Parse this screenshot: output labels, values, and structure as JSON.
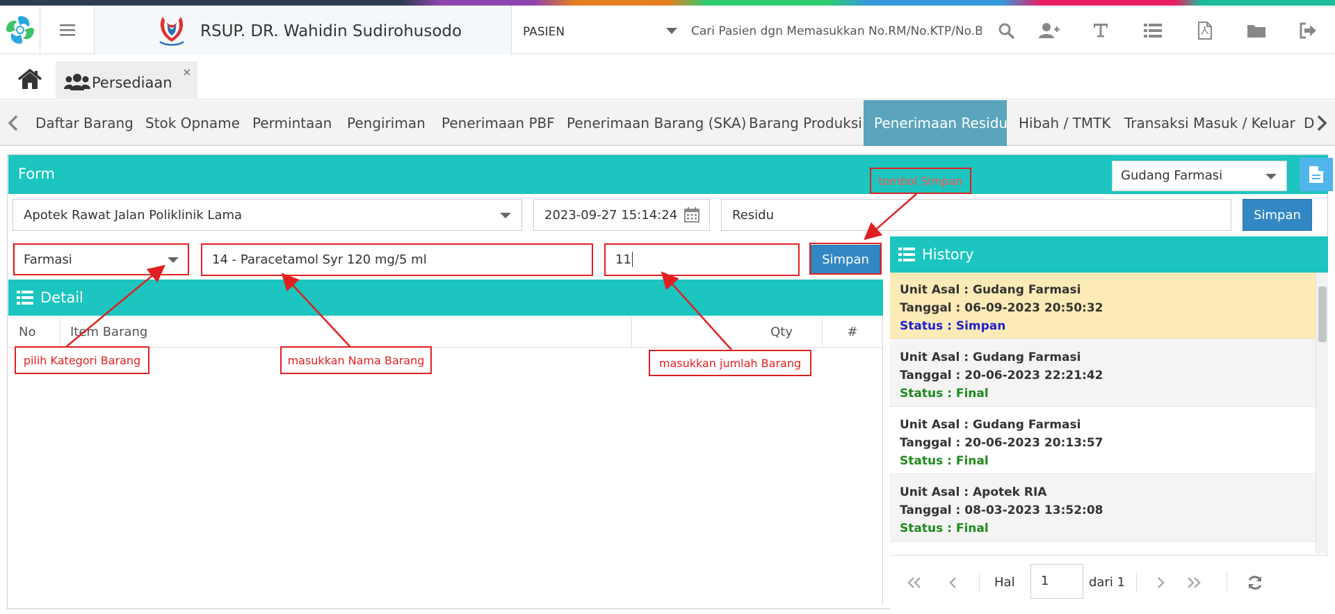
{
  "header": {
    "hospital_name": "RSUP. DR. Wahidin Sudirohusodo",
    "patient_select": "PASIEN",
    "search_placeholder": "Cari Pasien dgn Memasukkan No.RM/No.KTP/No.BPJS",
    "icons": [
      "search-icon",
      "add-user-icon",
      "text-icon",
      "list-icon",
      "pdf-icon",
      "folder-icon",
      "logout-icon"
    ]
  },
  "tabs": {
    "open_tab": "Persediaan",
    "close_symbol": "×"
  },
  "nav": {
    "items": [
      "Daftar Barang",
      "Stok Opname",
      "Permintaan",
      "Pengiriman",
      "Penerimaan PBF",
      "Penerimaan Barang (SKA)",
      "Barang Produksi",
      "Penerimaan Residu",
      "Hibah / TMTK",
      "Transaksi Masuk / Keluar",
      "D"
    ],
    "active": "Penerimaan Residu"
  },
  "form": {
    "title": "Form",
    "gudang": "Gudang Farmasi",
    "unit": "Apotek Rawat Jalan Poliklinik Lama",
    "datetime": "2023-09-27 15:14:24",
    "keterangan": "Residu",
    "save_label": "Simpan",
    "kategori": "Farmasi",
    "nama_barang": "14 - Paracetamol Syr 120 mg/5 ml",
    "qty": "11",
    "item_save_label": "Simpan"
  },
  "detail": {
    "title": "Detail",
    "columns": [
      "No",
      "Item Barang",
      "Qty",
      "#"
    ]
  },
  "history": {
    "title": "History",
    "items": [
      {
        "unit": "Unit Asal : Gudang Farmasi",
        "tanggal": "Tanggal : 06-09-2023 20:50:32",
        "status": "Status : Simpan"
      },
      {
        "unit": "Unit Asal : Gudang Farmasi",
        "tanggal": "Tanggal : 20-06-2023 22:21:42",
        "status": "Status : Final"
      },
      {
        "unit": "Unit Asal : Gudang Farmasi",
        "tanggal": "Tanggal : 20-06-2023 20:13:57",
        "status": "Status : Final"
      },
      {
        "unit": "Unit Asal : Apotek RIA",
        "tanggal": "Tanggal : 08-03-2023 13:52:08",
        "status": "Status : Final"
      }
    ],
    "pager": {
      "hal_label": "Hal",
      "page": "1",
      "of_label": "dari 1"
    }
  },
  "annotations": {
    "tombol_simpan": "tombol Simpan",
    "kategori": "pilih Kategori Barang",
    "nama": "masukkan Nama Barang",
    "jumlah": "masukkan jumlah Barang"
  },
  "colors": {
    "teal": "#1cc5bf",
    "active_tab": "#5aa5bd",
    "button_blue": "#3388c4",
    "annotation_red": "#e02020",
    "highlight_row": "#fcebb6"
  }
}
